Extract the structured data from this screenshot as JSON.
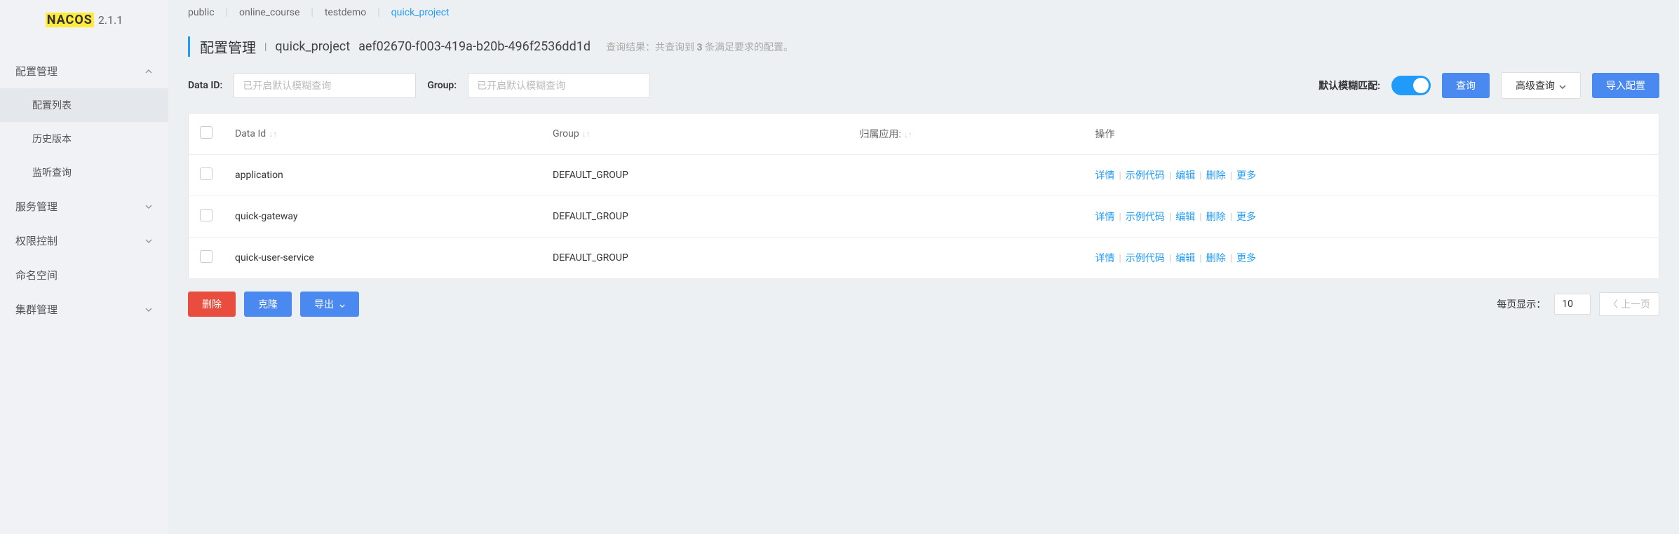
{
  "logo": {
    "name": "NACOS",
    "version": "2.1.1"
  },
  "sidebar": {
    "groups": [
      {
        "label": "配置管理",
        "expanded": true,
        "items": [
          {
            "label": "配置列表",
            "active": true
          },
          {
            "label": "历史版本"
          },
          {
            "label": "监听查询"
          }
        ]
      },
      {
        "label": "服务管理",
        "expanded": false
      },
      {
        "label": "权限控制",
        "expanded": false
      },
      {
        "label": "命名空间",
        "expanded": false,
        "noChevron": true
      },
      {
        "label": "集群管理",
        "expanded": false
      }
    ]
  },
  "tabs": [
    {
      "label": "public"
    },
    {
      "label": "online_course"
    },
    {
      "label": "testdemo"
    },
    {
      "label": "quick_project",
      "active": true
    }
  ],
  "header": {
    "title": "配置管理",
    "namespace": "quick_project",
    "nsId": "aef02670-f003-419a-b20b-496f2536dd1d",
    "resultPrefix": "查询结果：共查询到 ",
    "resultCount": "3",
    "resultSuffix": " 条满足要求的配置。"
  },
  "search": {
    "dataIdLabel": "Data ID:",
    "dataIdPlaceholder": "已开启默认模糊查询",
    "groupLabel": "Group:",
    "groupPlaceholder": "已开启默认模糊查询",
    "fuzzyLabel": "默认模糊匹配:",
    "queryBtn": "查询",
    "advancedBtn": "高级查询",
    "importBtn": "导入配置"
  },
  "table": {
    "cols": {
      "dataId": "Data Id",
      "group": "Group",
      "belong": "归属应用:",
      "ops": "操作"
    },
    "rows": [
      {
        "dataId": "application",
        "group": "DEFAULT_GROUP",
        "belong": ""
      },
      {
        "dataId": "quick-gateway",
        "group": "DEFAULT_GROUP",
        "belong": ""
      },
      {
        "dataId": "quick-user-service",
        "group": "DEFAULT_GROUP",
        "belong": ""
      }
    ],
    "actions": {
      "detail": "详情",
      "sample": "示例代码",
      "edit": "编辑",
      "delete": "删除",
      "more": "更多"
    }
  },
  "footer": {
    "deleteBtn": "删除",
    "cloneBtn": "克隆",
    "exportBtn": "导出",
    "pageSizeLabel": "每页显示：",
    "pageSize": "10",
    "prevBtn": "上一页"
  }
}
